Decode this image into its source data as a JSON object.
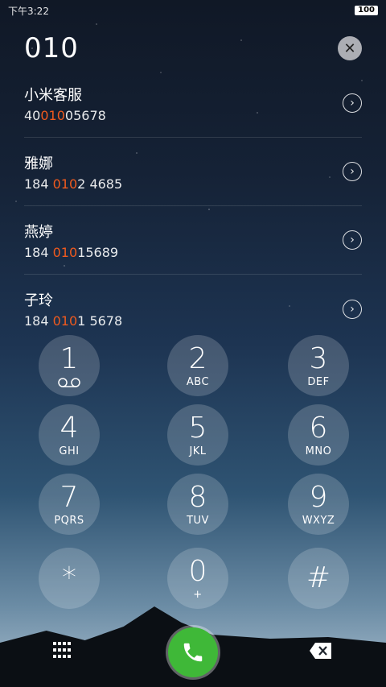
{
  "status_bar": {
    "time": "下午3:22",
    "battery": "100"
  },
  "search": {
    "dialed_number": "010"
  },
  "results": [
    {
      "name": "小米客服",
      "number_prefix": "40",
      "number_match": "010",
      "number_suffix": "05678"
    },
    {
      "name": "雅娜",
      "number_prefix": "184 ",
      "number_match": "010",
      "number_suffix": "2 4685"
    },
    {
      "name": "燕婷",
      "number_prefix": "184 ",
      "number_match": "010",
      "number_suffix": "15689"
    },
    {
      "name": "子玲",
      "number_prefix": "184 ",
      "number_match": "010",
      "number_suffix": "1 5678"
    }
  ],
  "keypad": [
    {
      "digit": "1",
      "letters": ""
    },
    {
      "digit": "2",
      "letters": "ABC"
    },
    {
      "digit": "3",
      "letters": "DEF"
    },
    {
      "digit": "4",
      "letters": "GHI"
    },
    {
      "digit": "5",
      "letters": "JKL"
    },
    {
      "digit": "6",
      "letters": "MNO"
    },
    {
      "digit": "7",
      "letters": "PQRS"
    },
    {
      "digit": "8",
      "letters": "TUV"
    },
    {
      "digit": "9",
      "letters": "WXYZ"
    },
    {
      "digit": "*",
      "letters": ""
    },
    {
      "digit": "0",
      "letters": "+"
    },
    {
      "digit": "#",
      "letters": ""
    }
  ],
  "icons": {
    "clear": "close-icon",
    "detail": "chevron-right-icon",
    "voicemail": "voicemail-icon",
    "dialpad": "dialpad-grid-icon",
    "call": "phone-icon",
    "backspace": "backspace-icon"
  },
  "colors": {
    "highlight": "#f05a1e",
    "call_button": "#3fb838"
  }
}
